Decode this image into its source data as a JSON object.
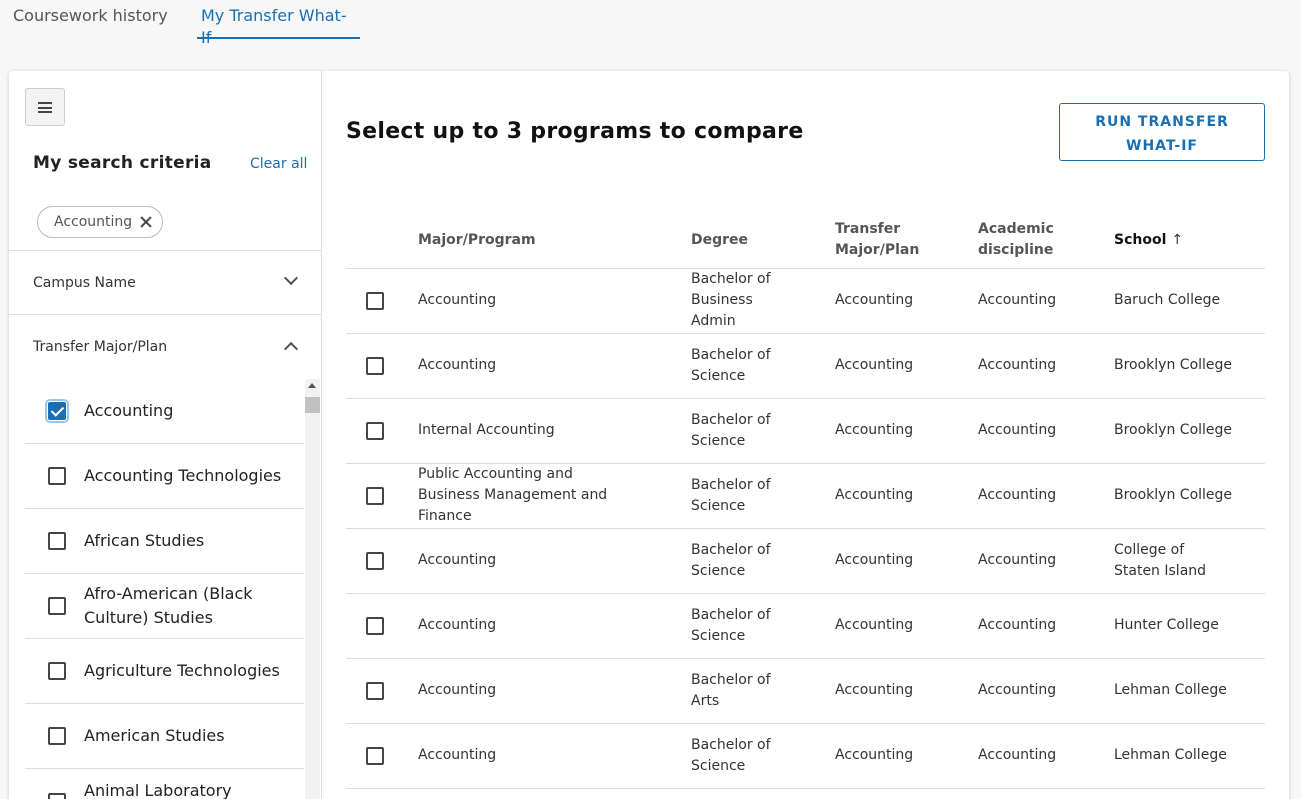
{
  "tabs": [
    {
      "label": "Coursework history"
    },
    {
      "label": "My Transfer What-If"
    }
  ],
  "sidebar": {
    "criteria_title": "My search criteria",
    "clear_all": "Clear all",
    "chip_label": "Accounting",
    "facets": [
      {
        "label": "Campus Name",
        "expanded": false
      },
      {
        "label": "Transfer Major/Plan",
        "expanded": true
      }
    ],
    "items": [
      {
        "label": "Accounting",
        "checked": true
      },
      {
        "label": "Accounting Technologies",
        "checked": false
      },
      {
        "label": "African Studies",
        "checked": false
      },
      {
        "label": "Afro-American (Black Culture) Studies",
        "checked": false
      },
      {
        "label": "Agriculture Technologies",
        "checked": false
      },
      {
        "label": "American Studies",
        "checked": false
      },
      {
        "label": "Animal Laboratory",
        "checked": false
      }
    ]
  },
  "main": {
    "title": "Select up to 3 programs to compare",
    "run_button": "RUN TRANSFER WHAT-IF",
    "columns": {
      "major": "Major/Program",
      "degree": "Degree",
      "transfer_major": "Transfer Major/Plan",
      "discipline": "Academic discipline",
      "school": "School",
      "school_sort_icon": "arrow-up-icon"
    },
    "rows": [
      {
        "major": "Accounting",
        "degree": "Bachelor of Business Admin",
        "transfer_major": "Accounting",
        "discipline": "Accounting",
        "school": "Baruch College"
      },
      {
        "major": "Accounting",
        "degree": "Bachelor of Science",
        "transfer_major": "Accounting",
        "discipline": "Accounting",
        "school": "Brooklyn College"
      },
      {
        "major": "Internal Accounting",
        "degree": "Bachelor of Science",
        "transfer_major": "Accounting",
        "discipline": "Accounting",
        "school": "Brooklyn College"
      },
      {
        "major": "Public Accounting and Business Management and Finance",
        "degree": "Bachelor of Science",
        "transfer_major": "Accounting",
        "discipline": "Accounting",
        "school": "Brooklyn College"
      },
      {
        "major": "Accounting",
        "degree": "Bachelor of Science",
        "transfer_major": "Accounting",
        "discipline": "Accounting",
        "school": "College of Staten Island"
      },
      {
        "major": "Accounting",
        "degree": "Bachelor of Science",
        "transfer_major": "Accounting",
        "discipline": "Accounting",
        "school": "Hunter College"
      },
      {
        "major": "Accounting",
        "degree": "Bachelor of Arts",
        "transfer_major": "Accounting",
        "discipline": "Accounting",
        "school": "Lehman College"
      },
      {
        "major": "Accounting",
        "degree": "Bachelor of Science",
        "transfer_major": "Accounting",
        "discipline": "Accounting",
        "school": "Lehman College"
      }
    ]
  },
  "colors": {
    "accent": "#1a6fb3",
    "border": "#dddddd",
    "background": "#f7f7f7"
  }
}
